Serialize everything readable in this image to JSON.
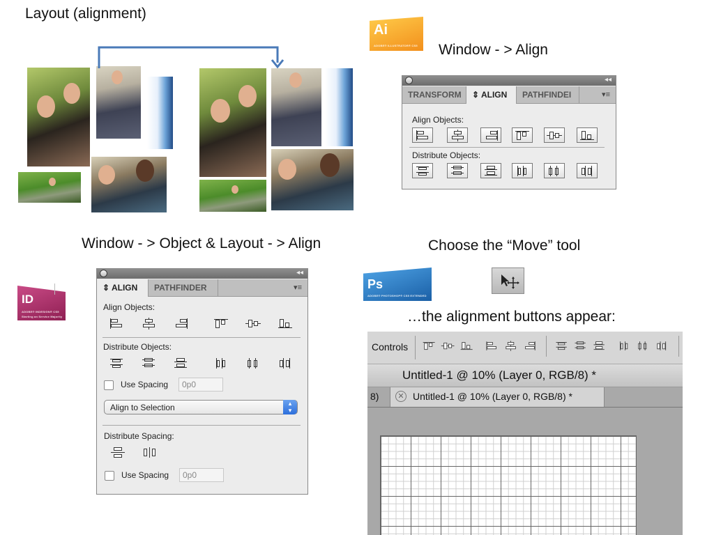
{
  "slide": {
    "title": "Layout (alignment)",
    "illustrator_caption": "Window - > Align",
    "indesign_caption": "Window - > Object & Layout - > Align",
    "photoshop_caption": "Choose the “Move” tool",
    "photoshop_result": "…the alignment buttons appear:"
  },
  "illustrator_icon": {
    "letters": "Ai",
    "subtitle": "ADOBE® ILLUSTRATOR® CS5",
    "color": "#f7a11a"
  },
  "indesign_icon": {
    "letters": "ID",
    "subtitle": "ADOBE® INDESIGN® CS5",
    "tagline": "Starting an Service Majority",
    "color": "#b3306a"
  },
  "photoshop_icon": {
    "letters": "Ps",
    "subtitle": "ADOBE® PHOTOSHOP® CS5 EXTENDED",
    "color": "#1f6fb5"
  },
  "ai_panel": {
    "tabs": [
      "TRANSFORM",
      "⇕ ALIGN",
      "PATHFINDEI"
    ],
    "active_tab": "⇕ ALIGN",
    "align_objects_label": "Align Objects:",
    "distribute_objects_label": "Distribute Objects:"
  },
  "id_panel": {
    "tabs": [
      "⇕ ALIGN",
      "PATHFINDER"
    ],
    "active_tab": "⇕ ALIGN",
    "align_objects_label": "Align Objects:",
    "distribute_objects_label": "Distribute Objects:",
    "use_spacing_label": "Use Spacing",
    "use_spacing_value": "0p0",
    "align_to_value": "Align to Selection",
    "distribute_spacing_label": "Distribute Spacing:",
    "use_spacing_label_2": "Use Spacing",
    "use_spacing_value_2": "0p0"
  },
  "ps": {
    "options_label": "Controls",
    "doc_title": "Untitled-1 @ 10% (Layer 0, RGB/8) *",
    "tab_prev": "8)",
    "tab_active": "Untitled-1 @ 10% (Layer 0, RGB/8) *"
  }
}
